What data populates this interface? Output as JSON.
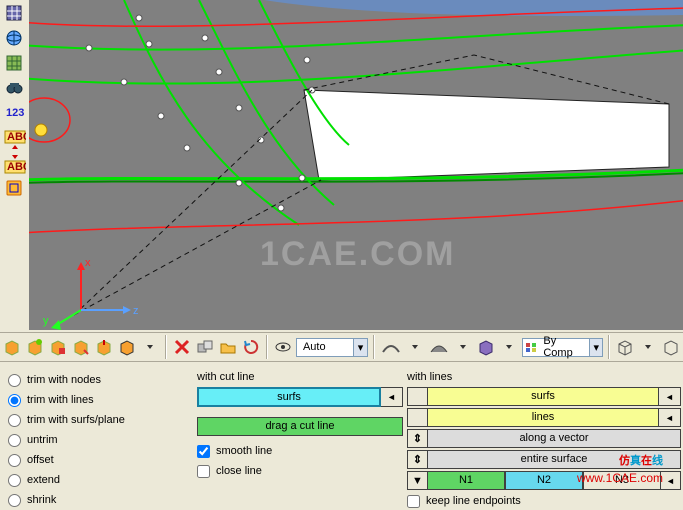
{
  "chart_data": null,
  "left_toolbar": {
    "icons": [
      "grid-icon",
      "globe-icon",
      "mesh-icon",
      "binoculars-icon",
      "numbers-123-icon",
      "abc-down-icon",
      "abc-up-icon",
      "select-box-icon"
    ]
  },
  "axis": {
    "x": "x",
    "y": "y",
    "z": "z"
  },
  "h_toolbar": {
    "auto_label": "Auto",
    "bycomp_label": "By Comp"
  },
  "panel": {
    "radios": [
      {
        "label": "trim with nodes",
        "checked": false
      },
      {
        "label": "trim with lines",
        "checked": true
      },
      {
        "label": "trim with surfs/plane",
        "checked": false
      },
      {
        "label": "untrim",
        "checked": false
      },
      {
        "label": "offset",
        "checked": false
      },
      {
        "label": "extend",
        "checked": false
      },
      {
        "label": "shrink",
        "checked": false
      }
    ],
    "col2_header": "with cut line",
    "surfs_btn": "surfs",
    "drag_btn": "drag a cut line",
    "smooth_label": "smooth line",
    "close_label": "close line",
    "col3_header": "with lines",
    "lines_btn": "lines",
    "along_vector": "along a vector",
    "entire_surface": "entire surface",
    "N1": "N1",
    "N2": "N2",
    "N3": "N3",
    "keep_label": "keep line endpoints",
    "toggle_arrow": "◄",
    "updown": "⇕",
    "dropdown": "▼"
  },
  "watermark": {
    "big": "1CAE.COM",
    "cn1": "仿",
    "cn2": "真",
    "cn3": "在",
    "cn4": "线",
    "url": "www.1CAE.com"
  }
}
